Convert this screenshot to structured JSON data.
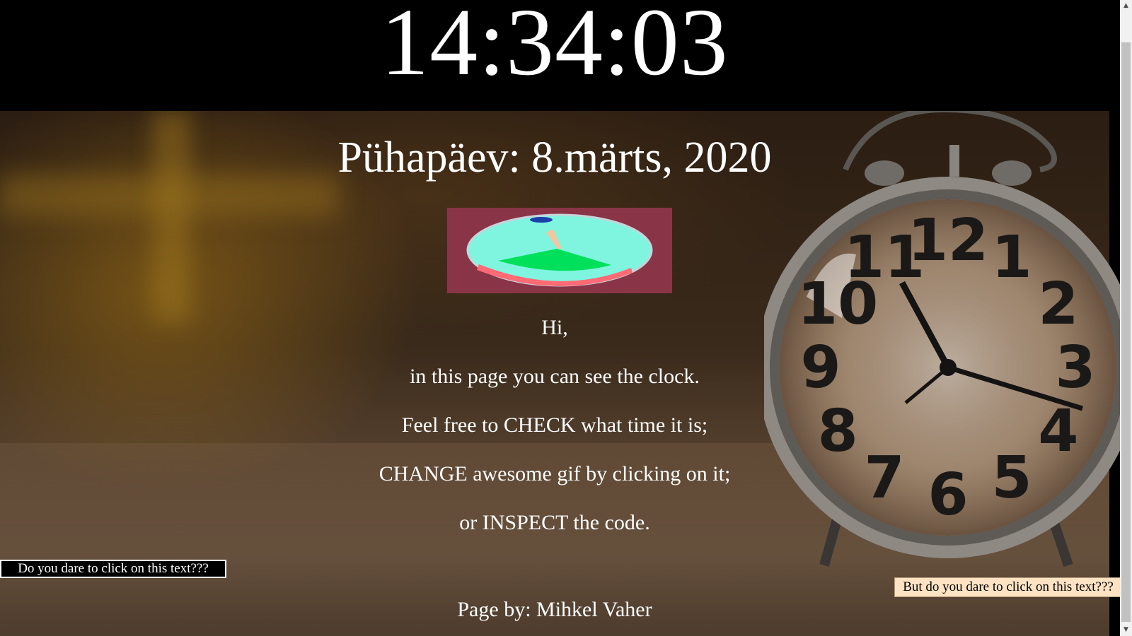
{
  "clock": {
    "time": "14:34:03"
  },
  "date": {
    "text": "Pühapäev: 8.märts, 2020"
  },
  "gif": {
    "icon": "sundial-animation"
  },
  "intro": {
    "lines": [
      "Hi,",
      "in this page you can see the clock.",
      "Feel free to CHECK what time it is;",
      "CHANGE awesome gif by clicking on it;",
      "or INSPECT the code."
    ]
  },
  "dare_left": {
    "label": "Do you dare to click on this text???"
  },
  "dare_right": {
    "label": "But do you dare to click on this text???"
  },
  "footer": {
    "text": "Page by: Mihkel Vaher"
  },
  "background": {
    "icon": "alarm-clock-photo",
    "clock_numbers": [
      "12",
      "1",
      "2",
      "3",
      "4",
      "5",
      "6",
      "7",
      "8",
      "9",
      "10",
      "11"
    ]
  },
  "colors": {
    "topbar": "#000000",
    "gif_background": "#8a3447",
    "gif_dial": "#7ff5e0",
    "gif_wedge": "#00e05a",
    "gif_rim": "#ff6b74",
    "dare_right_background": "#fde3c3"
  }
}
